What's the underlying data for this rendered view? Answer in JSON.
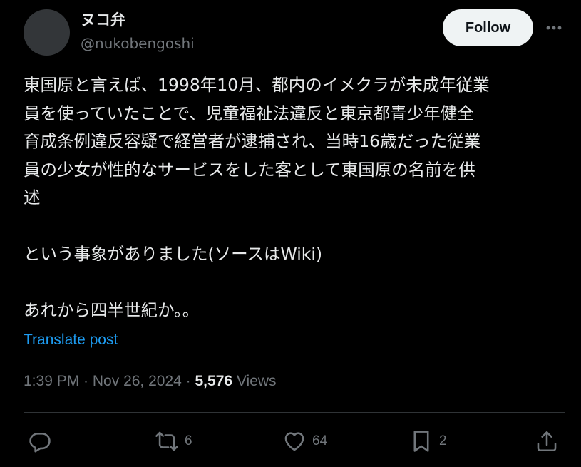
{
  "user": {
    "display_name": "ヌコ弁",
    "handle": "@nukobengoshi"
  },
  "follow_label": "Follow",
  "post": {
    "lines": [
      "東国原と言えば、1998年10月、都内のイメクラが未成年従業",
      "員を使っていたことで、児童福祉法違反と東京都青少年健全",
      "育成条例違反容疑で経営者が逮捕され、当時16歳だった従業",
      "員の少女が性的なサービスをした客として東国原の名前を供",
      "述",
      "",
      "という事象がありました(ソースはWiki)",
      "",
      "あれから四半世紀か。。"
    ]
  },
  "translate_label": "Translate post",
  "meta": {
    "time": "1:39 PM",
    "separator": " · ",
    "date": "Nov 26, 2024",
    "views_count": "5,576",
    "views_label": " Views"
  },
  "actions": {
    "reply": {
      "icon": "reply-icon",
      "count": ""
    },
    "repost": {
      "icon": "repost-icon",
      "count": "6"
    },
    "like": {
      "icon": "heart-icon",
      "count": "64"
    },
    "bookmark": {
      "icon": "bookmark-icon",
      "count": "2"
    },
    "share": {
      "icon": "share-icon",
      "count": ""
    }
  },
  "colors": {
    "background": "#000000",
    "text": "#e7e9ea",
    "secondary": "#71767b",
    "link": "#1d9bf0",
    "follow_bg": "#eff3f4"
  }
}
